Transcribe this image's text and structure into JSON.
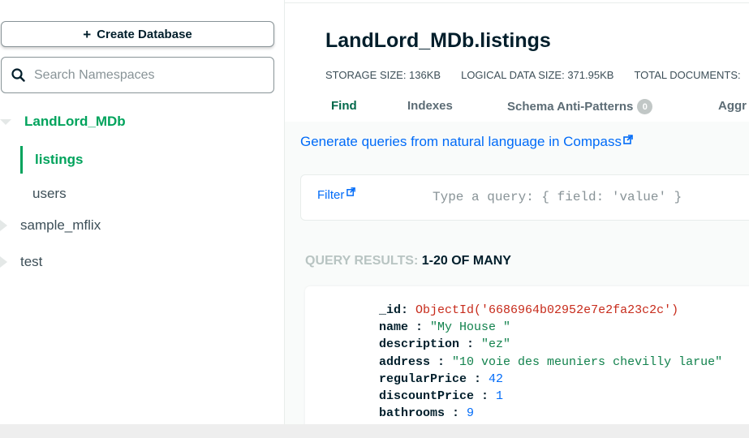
{
  "sidebar": {
    "create_button": "Create Database",
    "search_placeholder": "Search Namespaces",
    "databases": [
      {
        "name": "LandLord_MDb",
        "expanded": true,
        "collections": [
          "listings",
          "users"
        ],
        "active_collection": "listings"
      },
      {
        "name": "sample_mflix",
        "expanded": false
      },
      {
        "name": "test",
        "expanded": false
      }
    ]
  },
  "header": {
    "title": "LandLord_MDb.listings",
    "stats": [
      "STORAGE SIZE: 136KB",
      "LOGICAL DATA SIZE: 371.95KB",
      "TOTAL DOCUMENTS:"
    ]
  },
  "tabs": [
    {
      "label": "Find",
      "active": true
    },
    {
      "label": "Indexes"
    },
    {
      "label": "Schema Anti-Patterns",
      "badge": "0"
    },
    {
      "label": "Aggr"
    }
  ],
  "nl_link": "Generate queries from natural language in Compass",
  "filter": {
    "label": "Filter",
    "placeholder": "Type a query: { field: 'value' }"
  },
  "results": {
    "prefix": "QUERY RESULTS:",
    "range": "1-20 OF MANY"
  },
  "document": [
    {
      "key": "_id",
      "value": "ObjectId('6686964b02952e7e2fa23c2c')",
      "kind": "oid"
    },
    {
      "key": "name",
      "value": "\"My House \"",
      "kind": "str"
    },
    {
      "key": "description",
      "value": "\"ez\"",
      "kind": "str"
    },
    {
      "key": "address",
      "value": "\"10 voie des meuniers chevilly larue\"",
      "kind": "str"
    },
    {
      "key": "regularPrice",
      "value": "42",
      "kind": "num"
    },
    {
      "key": "discountPrice",
      "value": "1",
      "kind": "num"
    },
    {
      "key": "bathrooms",
      "value": "9",
      "kind": "num"
    }
  ],
  "colors": {
    "accent_green": "#00a35c",
    "tab_active": "#00684a",
    "link_blue": "#016bf8",
    "oid_red": "#c72b1b",
    "string_green": "#12824d"
  },
  "icons": [
    "plus-icon",
    "search-icon",
    "caret-down-icon",
    "caret-right-icon",
    "external-link-icon"
  ]
}
